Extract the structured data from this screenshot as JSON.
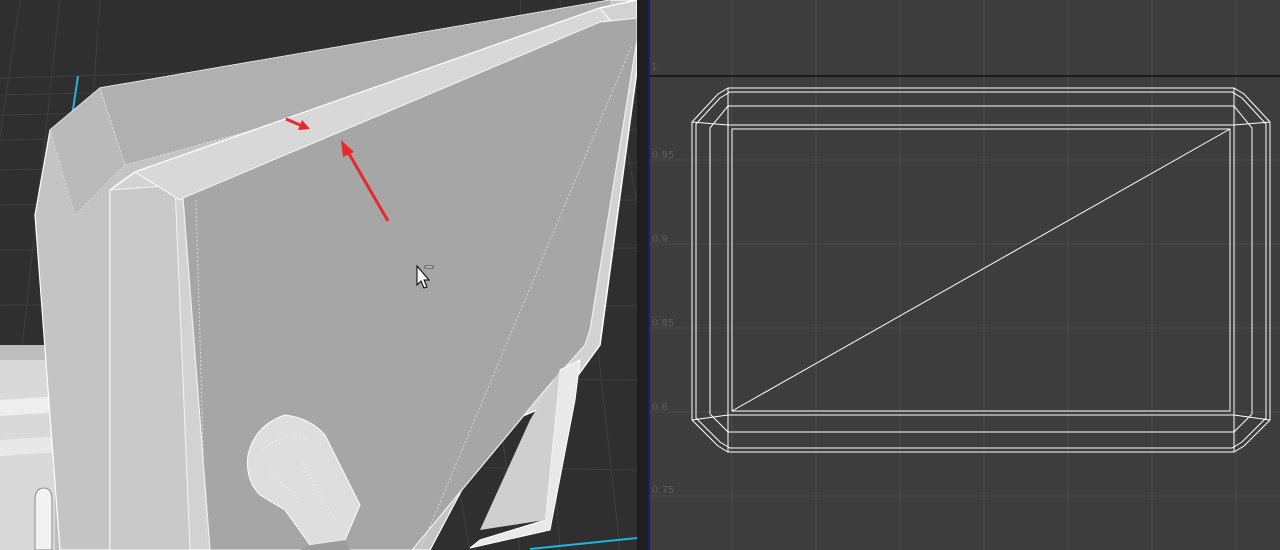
{
  "viewport_3d": {
    "mesh": "mesh",
    "annotations": [
      "red-arrow",
      "red-arrow"
    ]
  },
  "uv_editor": {
    "axis_top": "1",
    "axis_ticks": [
      "0.95",
      "0.9",
      "0.85",
      "0.8",
      "0.75"
    ],
    "grid_color": "#4a4a4a",
    "background_color": "#3d3d3d",
    "wire_color": "#ffffff",
    "axis_line_color": "#1b1b7a"
  },
  "colors": {
    "annotation_red": "#e8282b",
    "viewport_bg": "#2f2f2f",
    "mesh_face": "#a6a6a6",
    "selection_cyan": "#1fb4e6"
  },
  "cursor": "arrow-cursor-icon"
}
